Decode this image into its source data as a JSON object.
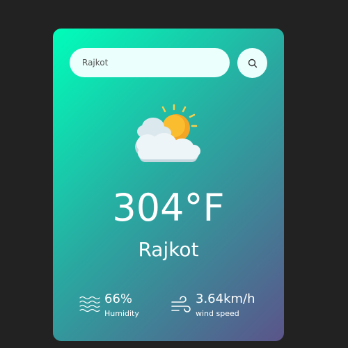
{
  "search": {
    "placeholder": "Rajkot"
  },
  "icons": {
    "search": "magnifier-icon",
    "weather": "partly-cloudy-sun-icon",
    "humidity": "humidity-waves-icon",
    "wind": "wind-icon"
  },
  "weather": {
    "temperature": "304°F",
    "city": "Rajkot"
  },
  "details": {
    "humidity": {
      "value": "66%",
      "label": "Humidity"
    },
    "wind": {
      "value": "3.64km/h",
      "label": "wind speed"
    }
  },
  "colors": {
    "page_background": "#222222",
    "card_gradient_start": "#00feba",
    "card_gradient_end": "#5b548a",
    "input_background": "#ebfffc",
    "text": "#ffffff"
  }
}
